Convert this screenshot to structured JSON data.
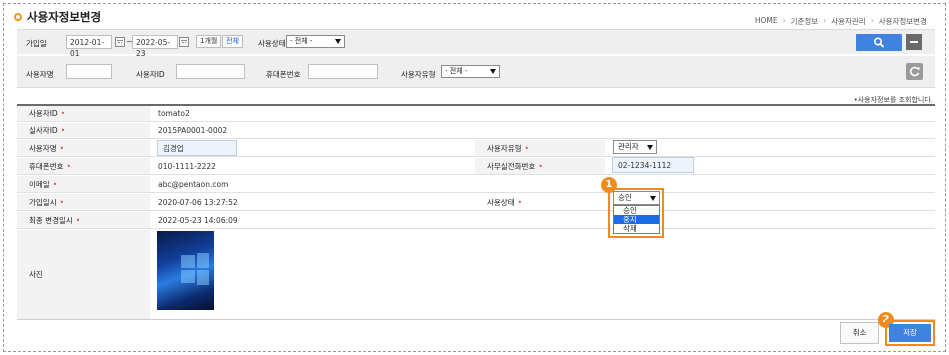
{
  "page": {
    "title": "사용자정보변경"
  },
  "breadcrumb": [
    "HOME",
    "기준정보",
    "사용자관리",
    "사용자정보변경"
  ],
  "search": {
    "join_label": "가입일",
    "date_from": "2012-01-01",
    "date_to": "2022-05-23",
    "tilde": "~",
    "one_month_label": "1개월",
    "all_label": "전체",
    "status_label": "사용상태",
    "status_value": "- 전체 -",
    "user_name_label": "사용자명",
    "user_id_label": "사용자ID",
    "mobile_label": "휴대폰번호",
    "user_type_label": "사용자유형",
    "user_type_value": "- 전체 -"
  },
  "hint": "•사용자정보를 조회합니다.",
  "form": {
    "user_id_label": "사용자ID",
    "user_id": "tomato2",
    "real_id_label": "실사자ID",
    "real_id": "2015PA0001-0002",
    "user_name_label": "사용자명",
    "user_name": "김경업",
    "user_type_label": "사용자유형",
    "user_type": "관리자",
    "mobile_label": "휴대폰번호",
    "mobile": "010-1111-2222",
    "office_phone_label": "사무실전화번호",
    "office_phone": "02-1234-1112",
    "email_label": "이메일",
    "email": "abc@pentaon.com",
    "join_date_label": "가입일시",
    "join_date": "2020-07-06 13:27:52",
    "status_label": "사용상태",
    "status": "승인",
    "status_options": [
      "승인",
      "중지",
      "삭제"
    ],
    "last_modified_label": "최종 변경일시",
    "last_modified": "2022-05-23 14:06:09",
    "photo_label": "사진",
    "required_mark": "•"
  },
  "annotations": {
    "step1": "1",
    "step2": "2"
  },
  "buttons": {
    "cancel": "취소",
    "save": "저장"
  },
  "colors": {
    "accent": "#f08b1e",
    "primary": "#3f82e0",
    "selected_option": "#1e6be6"
  }
}
